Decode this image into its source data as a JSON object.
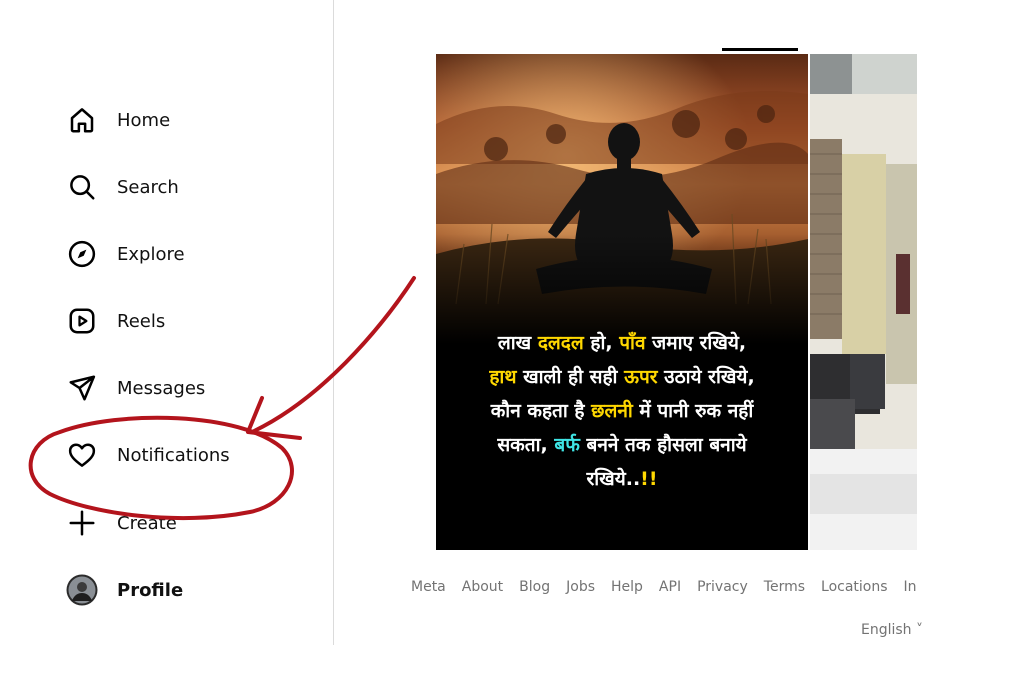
{
  "sidebar": {
    "items": [
      {
        "label": "Home",
        "icon": "home-icon"
      },
      {
        "label": "Search",
        "icon": "search-icon"
      },
      {
        "label": "Explore",
        "icon": "compass-icon"
      },
      {
        "label": "Reels",
        "icon": "reels-icon"
      },
      {
        "label": "Messages",
        "icon": "paper-plane-icon"
      },
      {
        "label": "Notifications",
        "icon": "heart-icon"
      },
      {
        "label": "Create",
        "icon": "plus-icon"
      },
      {
        "label": "Profile",
        "icon": "avatar"
      }
    ]
  },
  "post": {
    "lines": [
      {
        "parts": [
          "लाख ",
          "दलदल",
          " हो, ",
          "पाँव",
          " जमाए रखिये,"
        ]
      },
      {
        "parts": [
          "",
          "हाथ",
          " खाली ही सही ",
          "ऊपर",
          " उठाये रखिये,"
        ]
      },
      {
        "parts": [
          "कौन कहता है ",
          "छलनी",
          " में पानी रुक नहीं",
          "",
          ""
        ]
      },
      {
        "parts": [
          "सकता, ",
          "बर्फ",
          " बनने तक हौसला बनाये",
          "",
          ""
        ]
      },
      {
        "parts": [
          "रखिये..",
          "!!",
          "",
          "",
          ""
        ]
      }
    ]
  },
  "footer": {
    "links": [
      "Meta",
      "About",
      "Blog",
      "Jobs",
      "Help",
      "API",
      "Privacy",
      "Terms",
      "Locations",
      "In"
    ],
    "language": "English ˅"
  },
  "colors": {
    "annotation_red": "#b3141c",
    "highlight_yellow": "#ffd800",
    "highlight_cyan": "#3fe5e5",
    "footer_gray": "#737373"
  }
}
